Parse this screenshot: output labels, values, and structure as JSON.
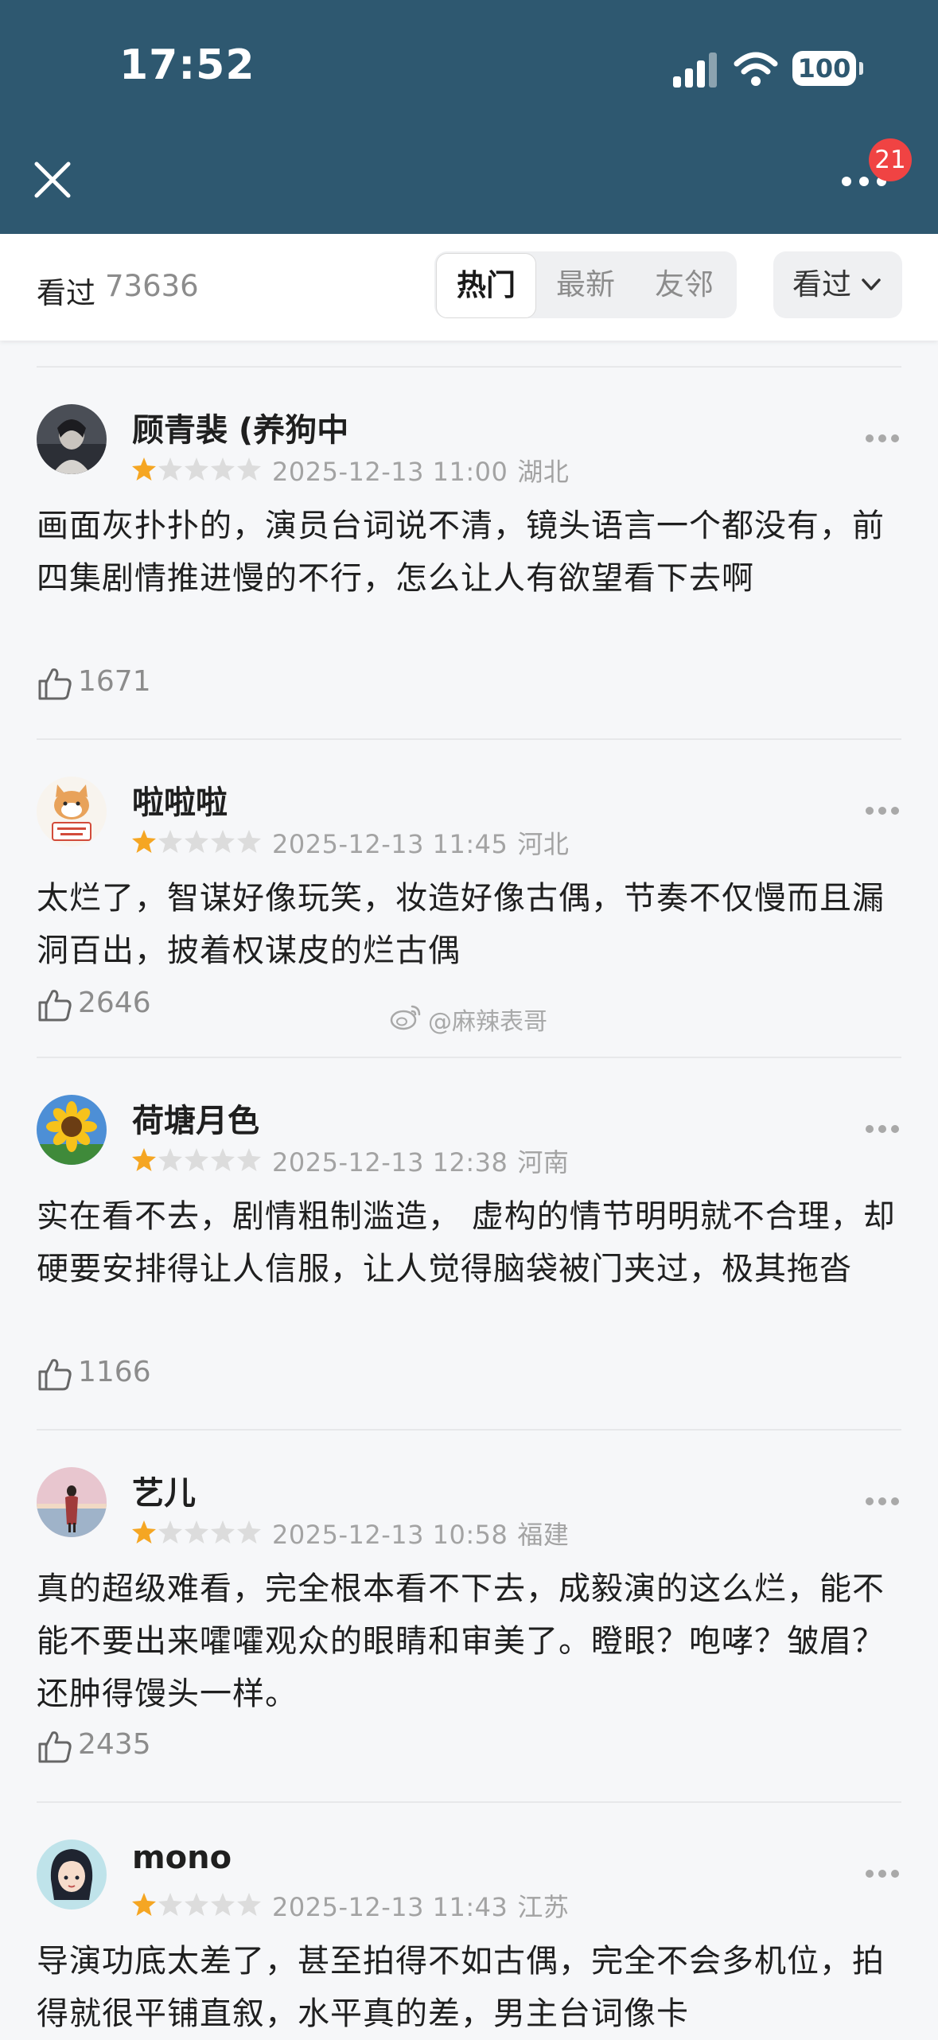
{
  "status_bar": {
    "time": "17:52",
    "battery": "100"
  },
  "header": {
    "notification_count": "21"
  },
  "filter_bar": {
    "count_label": "看过",
    "count_value": "73636",
    "tabs": [
      {
        "label": "热门"
      },
      {
        "label": "最新"
      },
      {
        "label": "友邻"
      }
    ],
    "active_tab": "热门",
    "dropdown_label": "看过"
  },
  "watermark": "@麻辣表哥",
  "reviews": [
    {
      "username": "顾青裴 (养狗中",
      "rating": 1,
      "date": "2025-12-13 11:00",
      "location": "湖北",
      "text": "画面灰扑扑的，演员台词说不清，镜头语言一个都没有，前四集剧情推进慢的不行，怎么让人有欲望看下去啊",
      "likes": "1671",
      "avatar": "dark-portrait-avatar"
    },
    {
      "username": "啦啦啦",
      "rating": 1,
      "date": "2025-12-13 11:45",
      "location": "河北",
      "text": "太烂了，智谋好像玩笑，妆造好像古偶，节奏不仅慢而且漏洞百出，披着权谋皮的烂古偶",
      "likes": "2646",
      "avatar": "shiba-dog-avatar"
    },
    {
      "username": "荷塘月色",
      "rating": 1,
      "date": "2025-12-13 12:38",
      "location": "河南",
      "text": "实在看不去，剧情粗制滥造， 虚构的情节明明就不合理，却硬要安排得让人信服，让人觉得脑袋被门夹过，极其拖沓",
      "likes": "1166",
      "avatar": "sunflower-avatar"
    },
    {
      "username": "艺儿",
      "rating": 1,
      "date": "2025-12-13 10:58",
      "location": "福建",
      "text": "真的超级难看，完全根本看不下去，成毅演的这么烂，能不能不要出来嚯嚯观众的眼睛和审美了。瞪眼？咆哮？皱眉？还肿得馒头一样。",
      "likes": "2435",
      "avatar": "beach-sunset-avatar"
    },
    {
      "username": "mono",
      "rating": 1,
      "date": "2025-12-13 11:43",
      "location": "江苏",
      "text": "导演功底太差了，甚至拍得不如古偶，完全不会多机位，拍得就很平铺直叙，水平真的差，男主台词像卡",
      "likes": "",
      "avatar": "anime-girl-avatar"
    }
  ],
  "colors": {
    "header_bg": "#2e5870",
    "star_filled": "#f5a623",
    "star_empty": "#dcdcdc",
    "badge": "#f04343"
  }
}
